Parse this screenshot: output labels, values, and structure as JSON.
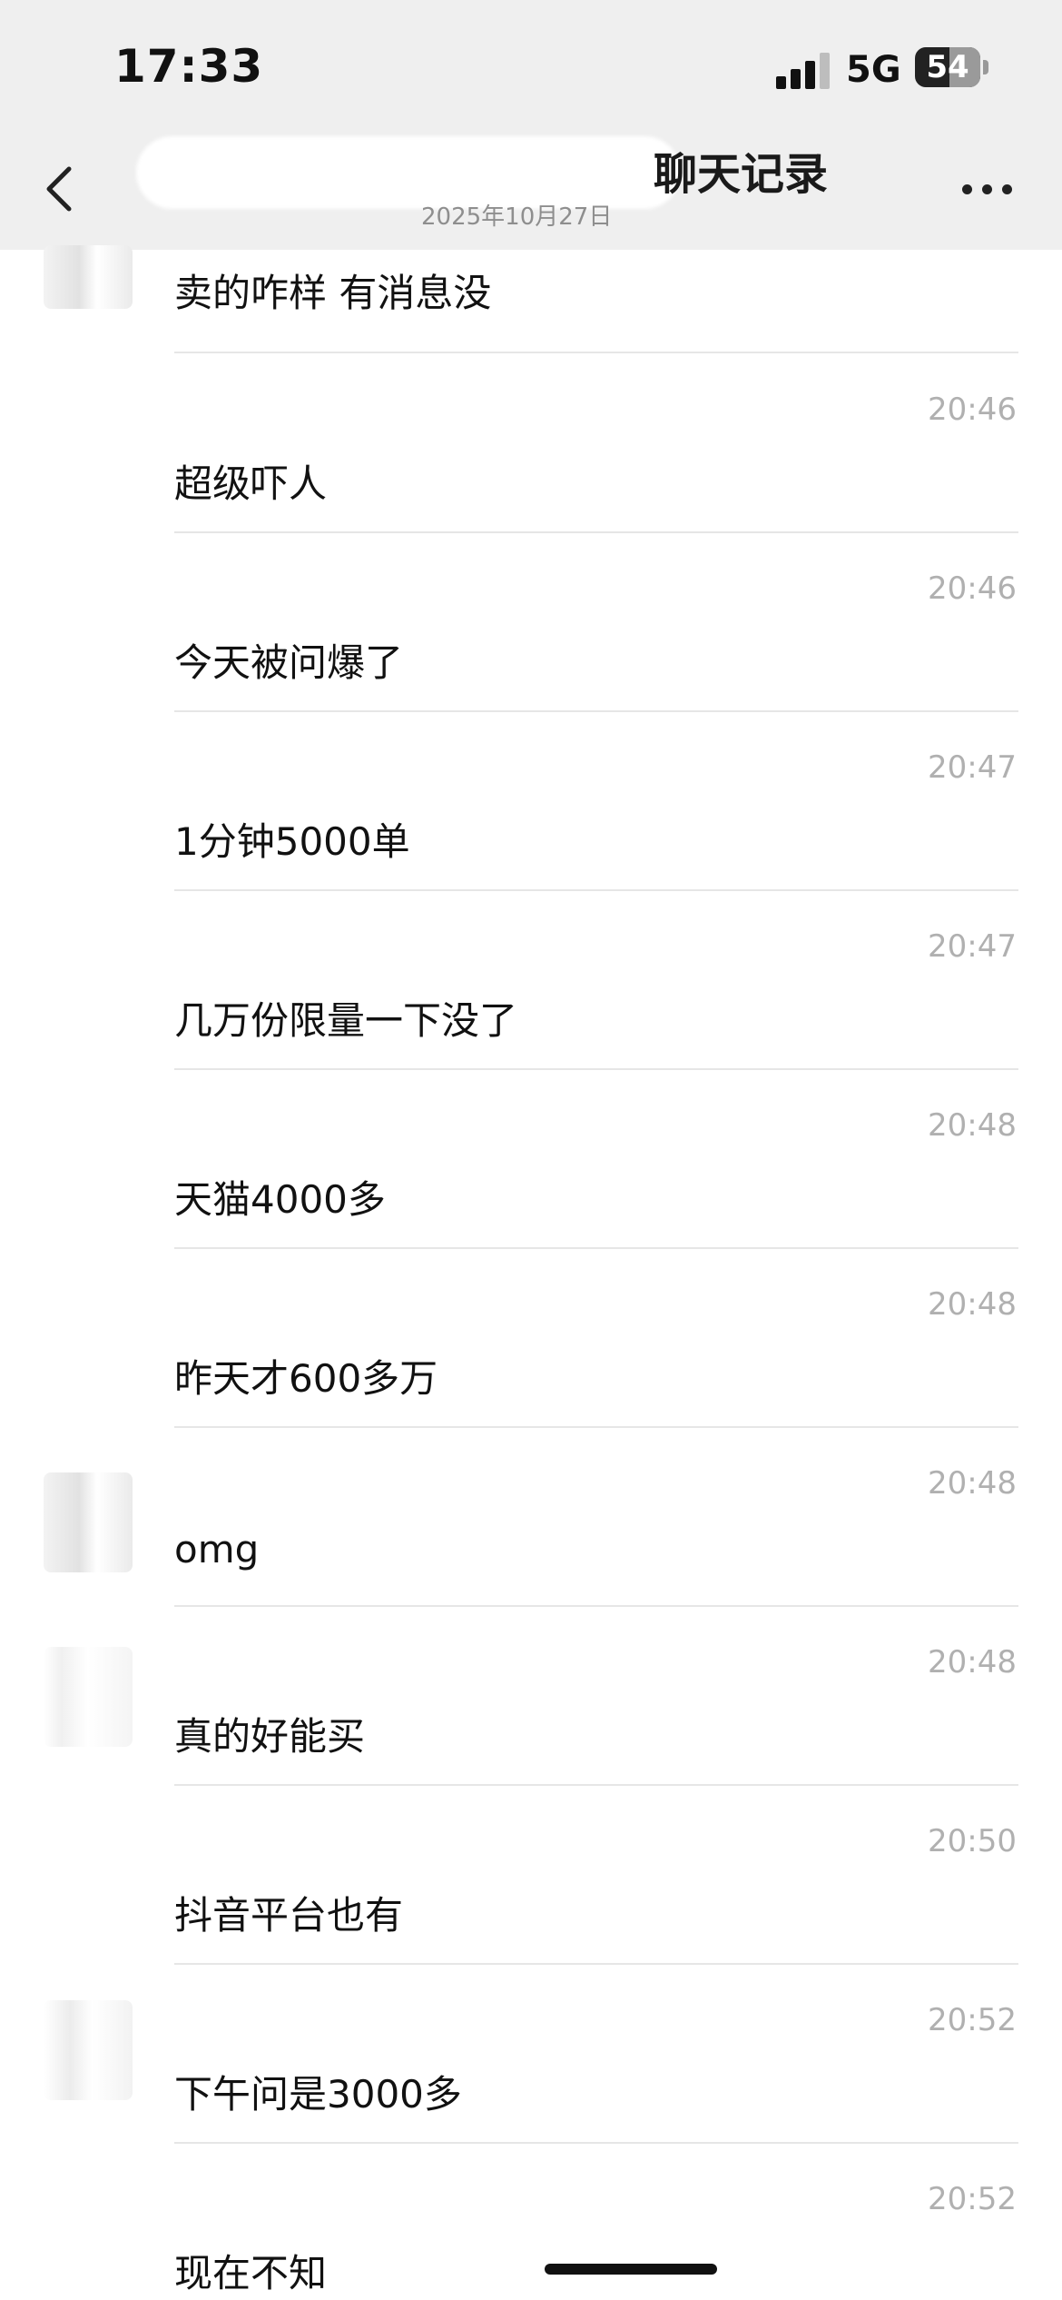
{
  "status_bar": {
    "time": "17:33",
    "network": "5G",
    "battery": "54"
  },
  "header": {
    "title": "聊天记录",
    "subtitle": "2025年10月27日"
  },
  "messages": [
    {
      "text": "卖的咋样 有消息没",
      "time": ""
    },
    {
      "text": "超级吓人",
      "time": "20:46"
    },
    {
      "text": "今天被问爆了",
      "time": "20:46"
    },
    {
      "text": "1分钟5000单",
      "time": "20:47"
    },
    {
      "text": "几万份限量一下没了",
      "time": "20:47"
    },
    {
      "text": "天猫4000多",
      "time": "20:48"
    },
    {
      "text": "昨天才600多万",
      "time": "20:48"
    },
    {
      "text": "omg",
      "time": "20:48"
    },
    {
      "text": "真的好能买",
      "time": "20:48"
    },
    {
      "text": "抖音平台也有",
      "time": "20:50"
    },
    {
      "text": "下午问是3000多",
      "time": "20:52"
    },
    {
      "text": "现在不知",
      "time": "20:52"
    }
  ],
  "icons": [
    "back-icon",
    "more-icon",
    "signal-icon",
    "battery-icon"
  ]
}
